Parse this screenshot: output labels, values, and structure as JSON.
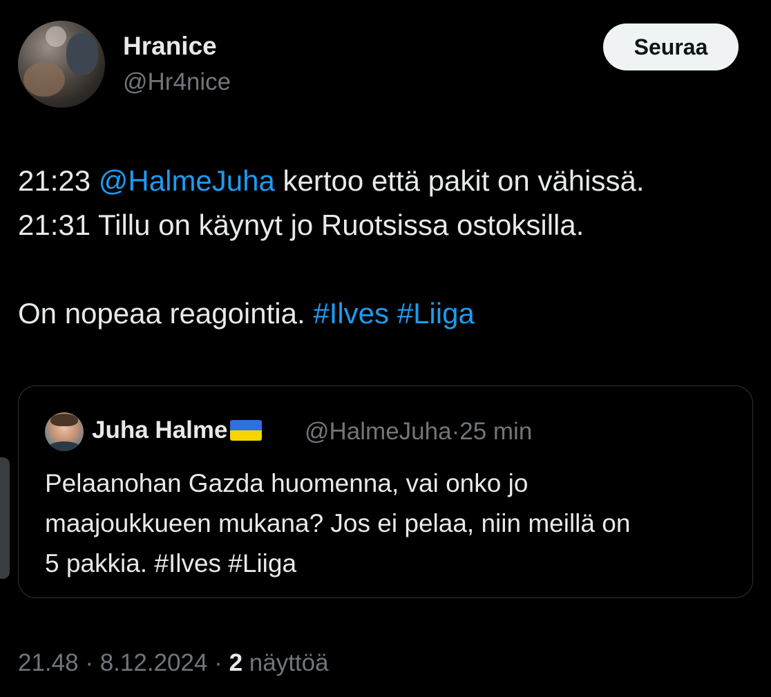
{
  "author": {
    "name": "Hranice",
    "handle": "@Hr4nice",
    "follow_label": "Seuraa"
  },
  "tweet": {
    "line1_time": "21:23",
    "line1_mention": "@HalmeJuha",
    "line1_text": "kertoo että pakit on vähissä.",
    "line2": "21:31 Tillu on käynyt jo Ruotsissa ostoksilla.",
    "line3_text": "On nopeaa reagointia.",
    "hashtag1": "#Ilves",
    "hashtag2": "#Liiga"
  },
  "quoted": {
    "name": "Juha Halme",
    "handle": "@HalmeJuha",
    "separator": "·",
    "time": "25 min",
    "lines": [
      "Pelaanohan Gazda huomenna, vai onko jo",
      "maajoukkueen mukana? Jos ei pelaa, niin meillä on",
      "5 pakkia. #Ilves #Liiga"
    ]
  },
  "footer": {
    "time": "21.48",
    "date": "8.12.2024",
    "views_count": "2",
    "views_label": "näyttöä",
    "separator": "·"
  },
  "colors": {
    "background": "#000000",
    "text": "#e7e9ea",
    "secondary": "#71767b",
    "link": "#1d9bf0",
    "border": "#2f3336"
  },
  "icons": {
    "flag": "ukraine-flag-icon"
  }
}
